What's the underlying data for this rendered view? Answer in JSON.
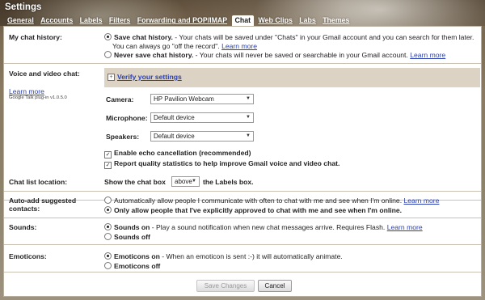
{
  "header": {
    "title": "Settings",
    "tabs": [
      "General",
      "Accounts",
      "Labels",
      "Filters",
      "Forwarding and POP/IMAP",
      "Chat",
      "Web Clips",
      "Labs",
      "Themes"
    ],
    "active_tab": "Chat"
  },
  "chat_history": {
    "label": "My chat history:",
    "opt_save_title": "Save chat history.",
    "opt_save_text1": " - Your chats will be saved under \"Chats\" in your Gmail account and you can search for them later.",
    "opt_save_text2": "You can always go \"off the record\".",
    "learn_more": "Learn more",
    "opt_never_title": "Never save chat history.",
    "opt_never_text": " - Your chats will never be saved or searchable in your Gmail account."
  },
  "voice": {
    "label": "Voice and video chat:",
    "learn_more": "Learn more",
    "plugin": "Google Talk plug-in v1.0.5.0",
    "verify": "Verify your settings",
    "camera_label": "Camera:",
    "camera_value": "HP Pavilion Webcam",
    "mic_label": "Microphone:",
    "mic_value": "Default device",
    "speakers_label": "Speakers:",
    "speakers_value": "Default device",
    "echo": "Enable echo cancellation (recommended)",
    "stats": "Report quality statistics to help improve Gmail voice and video chat."
  },
  "chat_list": {
    "label": "Chat list location:",
    "pre": "Show the chat box",
    "value": "above",
    "post": "the Labels box."
  },
  "auto_add": {
    "label": "Auto-add suggested contacts:",
    "opt_auto": "Automatically allow people I communicate with often to chat with me and see when I'm online.",
    "learn_more": "Learn more",
    "opt_only": "Only allow people that I've explicitly approved to chat with me and see when I'm online."
  },
  "sounds": {
    "label": "Sounds:",
    "on_title": "Sounds on",
    "on_text": " - Play a sound notification when new chat messages arrive. Requires Flash.",
    "learn_more": "Learn more",
    "off": "Sounds off"
  },
  "emoticons": {
    "label": "Emoticons:",
    "on_title": "Emoticons on",
    "on_text": " - When an emoticon is sent :-) it will automatically animate.",
    "off": "Emoticons off"
  },
  "footer": {
    "save": "Save Changes",
    "cancel": "Cancel"
  }
}
